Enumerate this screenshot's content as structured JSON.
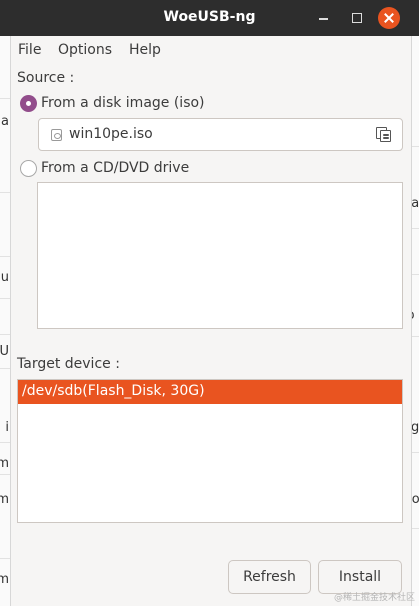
{
  "window": {
    "title": "WoeUSB-ng",
    "close_color": "#e95420"
  },
  "menu": {
    "file": "File",
    "options": "Options",
    "help": "Help"
  },
  "source": {
    "label": "Source :",
    "disk_image_option": "From a disk image (iso)",
    "disk_image_selected": true,
    "file_value": "win10pe.iso",
    "cd_option": "From a CD/DVD drive",
    "cd_selected": false
  },
  "target": {
    "label": "Target device :",
    "devices": [
      "/dev/sdb(Flash_Disk, 30G)"
    ],
    "selected_color": "#e95420"
  },
  "buttons": {
    "refresh": "Refresh",
    "install": "Install"
  },
  "background": {
    "left_fragments": [
      "ma",
      "ou",
      "U",
      "i",
      "m",
      "m",
      "m"
    ],
    "right_fragments": [
      "na",
      "io",
      "ag",
      "tio"
    ]
  },
  "watermark": "@稀土掘金技术社区"
}
